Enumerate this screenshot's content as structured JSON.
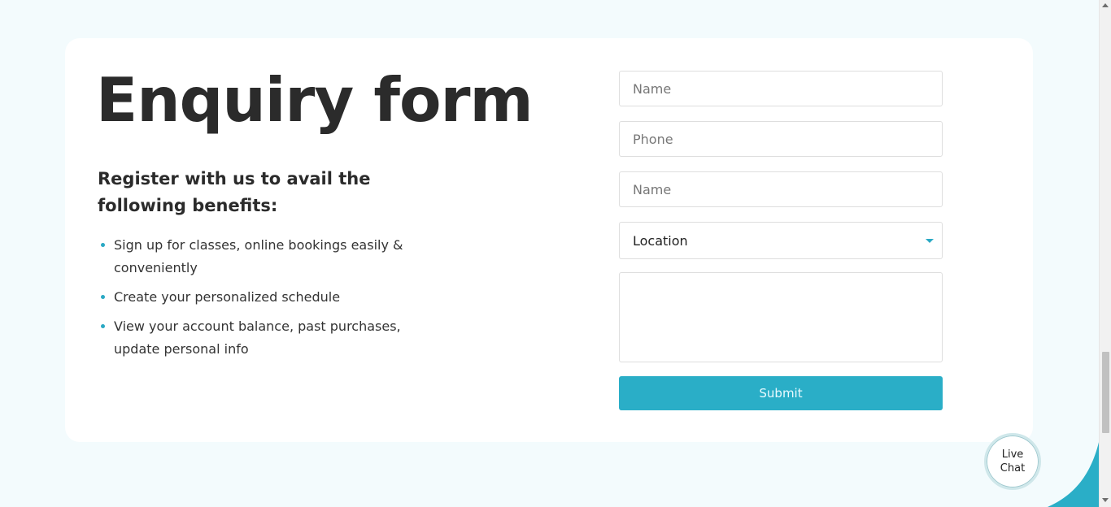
{
  "enquiry": {
    "title": "Enquiry form",
    "subtitle": "Register with us to avail the following benefits:",
    "benefits": [
      "Sign up for classes, online bookings easily & conveniently",
      "Create your personalized schedule",
      "View your account balance, past purchases, update personal info"
    ]
  },
  "form": {
    "name_placeholder": "Name",
    "phone_placeholder": "Phone",
    "name2_placeholder": "Name",
    "location_value": "Location",
    "message_placeholder": "",
    "submit_label": "Submit"
  },
  "livechat": {
    "line1": "Live",
    "line2": "Chat"
  },
  "colors": {
    "accent": "#2aaec7",
    "background": "#f3fbfd"
  }
}
